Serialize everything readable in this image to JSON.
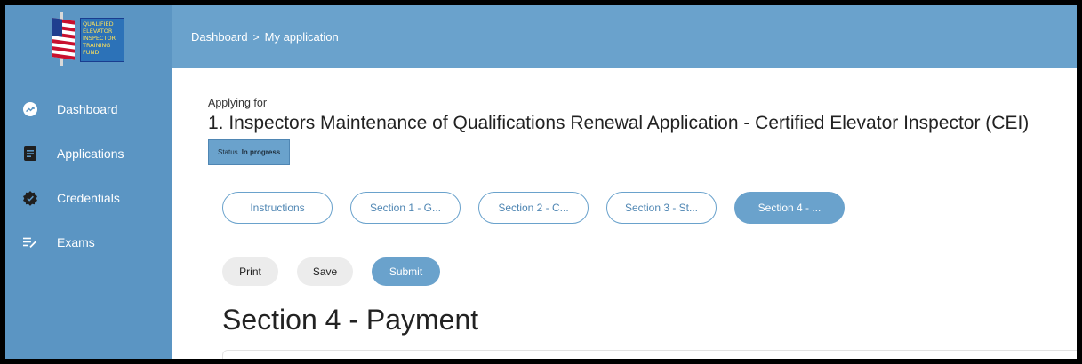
{
  "brand": {
    "logo_lines": [
      "QUALIFIED",
      "ELEVATOR",
      "INSPECTOR",
      "TRAINING",
      "FUND"
    ]
  },
  "colors": {
    "sidebar": "#5b95c3",
    "topbar": "#6aa2cc",
    "accent": "#6aa2cc"
  },
  "breadcrumb": {
    "items": [
      "Dashboard",
      "My application"
    ],
    "separator": ">"
  },
  "sidebar": {
    "items": [
      {
        "label": "Dashboard",
        "icon": "trending-up-icon"
      },
      {
        "label": "Applications",
        "icon": "document-icon"
      },
      {
        "label": "Credentials",
        "icon": "verified-badge-icon"
      },
      {
        "label": "Exams",
        "icon": "list-edit-icon"
      }
    ]
  },
  "application": {
    "applying_label": "Applying for",
    "title": "1. Inspectors Maintenance of Qualifications Renewal Application - Certified Elevator Inspector (CEI)",
    "status_label": "Status",
    "status_value": "In progress"
  },
  "tabs": [
    {
      "label": "Instructions",
      "active": false
    },
    {
      "label": "Section 1 - G...",
      "active": false
    },
    {
      "label": "Section 2 - C...",
      "active": false
    },
    {
      "label": "Section 3 - St...",
      "active": false
    },
    {
      "label": "Section 4 - ...",
      "active": true
    }
  ],
  "actions": {
    "print": "Print",
    "save": "Save",
    "submit": "Submit"
  },
  "section": {
    "heading": "Section 4 - Payment"
  }
}
